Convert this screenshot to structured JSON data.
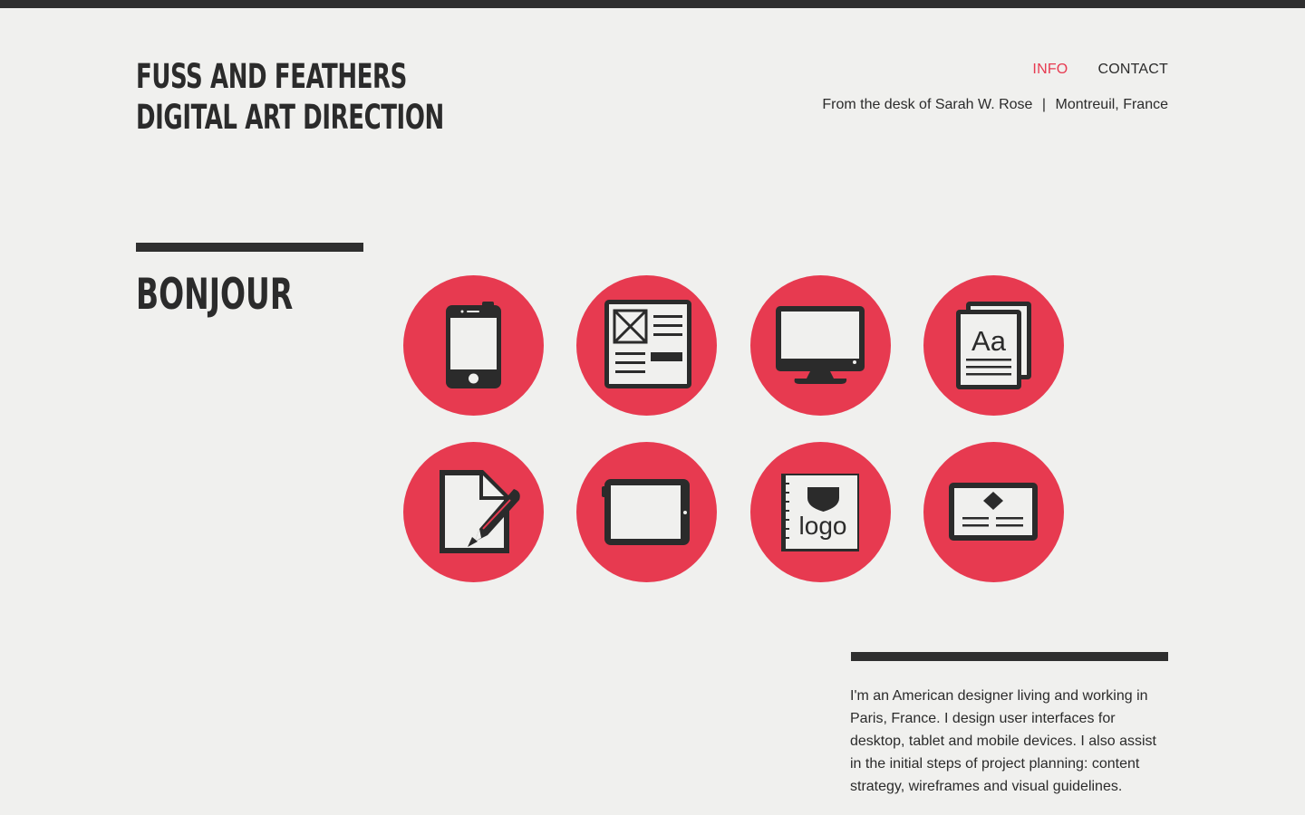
{
  "brand": {
    "line1": "FUSS AND FEATHERS",
    "line2": "DIGITAL ART DIRECTION"
  },
  "nav": {
    "info": "INFO",
    "contact": "CONTACT"
  },
  "tagline": {
    "left": "From the desk of Sarah W. Rose",
    "separator": "|",
    "right": "Montreuil, France"
  },
  "section": {
    "heading": "BONJOUR"
  },
  "icons": [
    {
      "name": "smartphone-icon"
    },
    {
      "name": "wireframe-icon"
    },
    {
      "name": "desktop-monitor-icon"
    },
    {
      "name": "typography-icon",
      "text": "Aa"
    },
    {
      "name": "document-edit-icon"
    },
    {
      "name": "tablet-icon"
    },
    {
      "name": "logo-book-icon",
      "text": "logo"
    },
    {
      "name": "business-card-icon"
    }
  ],
  "about": {
    "text": "I'm an American designer living and working in Paris, France. I design user interfaces for desktop, tablet and mobile devices. I also assist in the initial steps of project planning: content strategy, wireframes and visual guidelines."
  },
  "colors": {
    "accent": "#e73a50",
    "dark": "#2b2b2b",
    "background": "#f0f0ee"
  }
}
